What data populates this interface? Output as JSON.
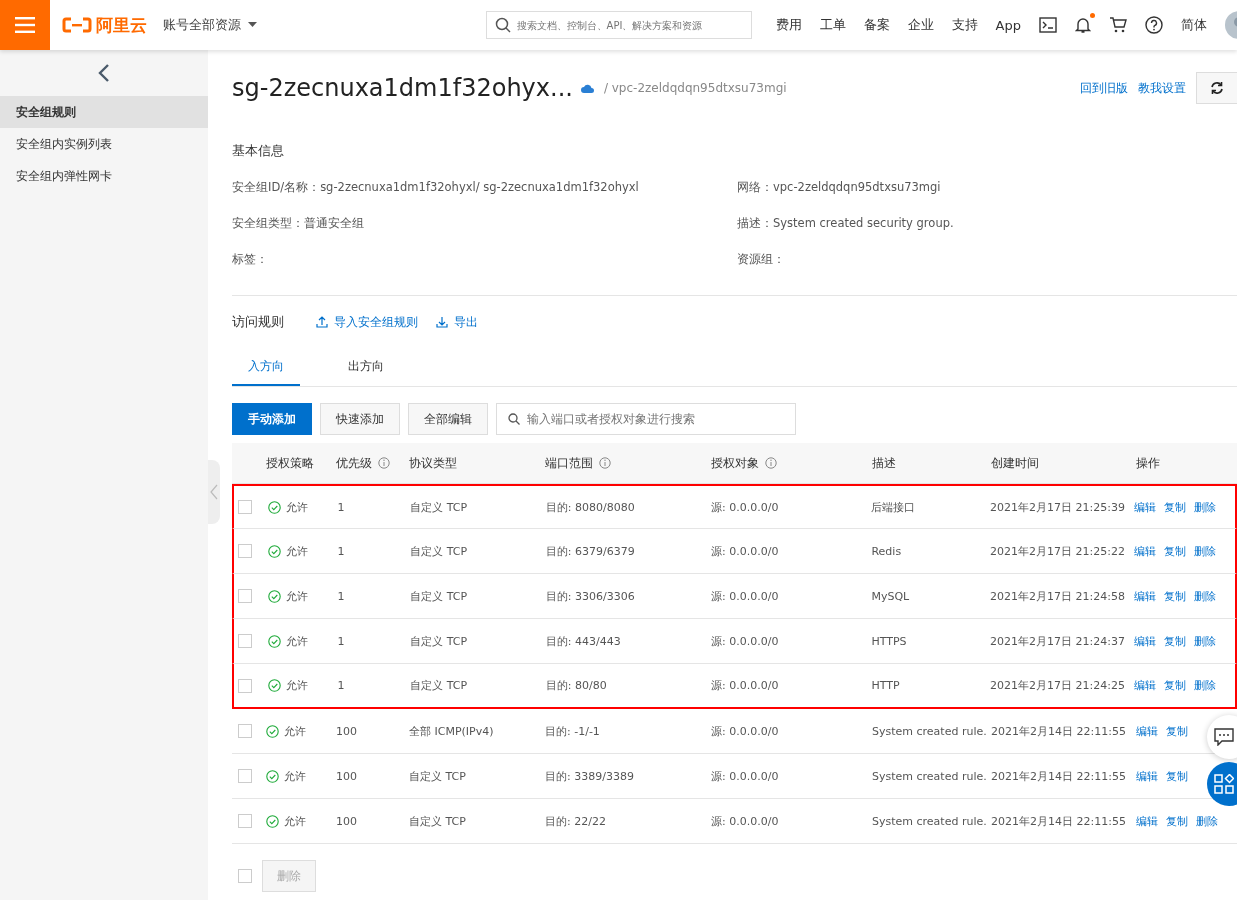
{
  "topbar": {
    "logo_text": "阿里云",
    "account": "账号全部资源",
    "search": {
      "placeholder": "搜索文档、控制台、API、解决方案和资源"
    },
    "nav": [
      "费用",
      "工单",
      "备案",
      "企业",
      "支持",
      "App"
    ],
    "notification_dot": true,
    "language": "简体"
  },
  "sidebar": {
    "items": [
      {
        "label": "安全组规则",
        "selected": true
      },
      {
        "label": "安全组内实例列表",
        "selected": false
      },
      {
        "label": "安全组内弹性网卡",
        "selected": false
      }
    ]
  },
  "header": {
    "title": "sg-2zecnuxa1dm1f32ohyx...",
    "vpc": "/ vpc-2zeldqdqn95dtxsu73mgi",
    "links": [
      "回到旧版",
      "教我设置"
    ]
  },
  "basic_info": {
    "heading": "基本信息",
    "fields": [
      {
        "label": "安全组ID/名称：",
        "value": "sg-2zecnuxa1dm1f32ohyxl/ sg-2zecnuxa1dm1f32ohyxl"
      },
      {
        "label": "网络：",
        "value": "vpc-2zeldqdqn95dtxsu73mgi"
      },
      {
        "label": "安全组类型：",
        "value": "普通安全组"
      },
      {
        "label": "描述：",
        "value": "System created security group."
      },
      {
        "label": "标签："
      },
      {
        "label": "资源组："
      }
    ]
  },
  "rules": {
    "heading": "访问规则",
    "actions": [
      {
        "label": "导入安全组规则",
        "kind": "upload"
      },
      {
        "label": "导出",
        "kind": "download"
      }
    ],
    "tabs": [
      {
        "label": "入方向",
        "selected": true
      },
      {
        "label": "出方向",
        "selected": false
      }
    ],
    "buttons": [
      {
        "label": "手动添加",
        "kind": "primary"
      },
      {
        "label": "快速添加",
        "kind": "default"
      },
      {
        "label": "全部编辑",
        "kind": "default"
      }
    ],
    "search": {
      "placeholder": "输入端口或者授权对象进行搜索"
    },
    "table": {
      "columns": [
        {
          "label": "授权策略",
          "info": false
        },
        {
          "label": "优先级",
          "info": true
        },
        {
          "label": "协议类型",
          "info": false
        },
        {
          "label": "端口范围",
          "info": true
        },
        {
          "label": "授权对象",
          "info": true
        },
        {
          "label": "描述",
          "info": false
        },
        {
          "label": "创建时间",
          "info": false
        },
        {
          "label": "操作",
          "info": false
        }
      ],
      "rows": [
        {
          "checked": false,
          "highlighted": true,
          "policy": "允许",
          "priority": "1",
          "protocol": "自定义 TCP",
          "ports": "目的: 8080/8080",
          "source": "源: 0.0.0.0/0",
          "description": "后端接口",
          "created": "2021年2月17日 21:25:39",
          "actions": [
            "编辑",
            "复制",
            "删除"
          ]
        },
        {
          "checked": false,
          "highlighted": true,
          "policy": "允许",
          "priority": "1",
          "protocol": "自定义 TCP",
          "ports": "目的: 6379/6379",
          "source": "源: 0.0.0.0/0",
          "description": "Redis",
          "created": "2021年2月17日 21:25:22",
          "actions": [
            "编辑",
            "复制",
            "删除"
          ]
        },
        {
          "checked": false,
          "highlighted": true,
          "policy": "允许",
          "priority": "1",
          "protocol": "自定义 TCP",
          "ports": "目的: 3306/3306",
          "source": "源: 0.0.0.0/0",
          "description": "MySQL",
          "created": "2021年2月17日 21:24:58",
          "actions": [
            "编辑",
            "复制",
            "删除"
          ]
        },
        {
          "checked": false,
          "highlighted": true,
          "policy": "允许",
          "priority": "1",
          "protocol": "自定义 TCP",
          "ports": "目的: 443/443",
          "source": "源: 0.0.0.0/0",
          "description": "HTTPS",
          "created": "2021年2月17日 21:24:37",
          "actions": [
            "编辑",
            "复制",
            "删除"
          ]
        },
        {
          "checked": false,
          "highlighted": true,
          "policy": "允许",
          "priority": "1",
          "protocol": "自定义 TCP",
          "ports": "目的: 80/80",
          "source": "源: 0.0.0.0/0",
          "description": "HTTP",
          "created": "2021年2月17日 21:24:25",
          "actions": [
            "编辑",
            "复制",
            "删除"
          ]
        },
        {
          "checked": false,
          "highlighted": false,
          "policy": "允许",
          "priority": "100",
          "protocol": "全部 ICMP(IPv4)",
          "ports": "目的: -1/-1",
          "source": "源: 0.0.0.0/0",
          "description": "System created rule.",
          "created": "2021年2月14日 22:11:55",
          "actions": [
            "编辑",
            "复制"
          ]
        },
        {
          "checked": false,
          "highlighted": false,
          "policy": "允许",
          "priority": "100",
          "protocol": "自定义 TCP",
          "ports": "目的: 3389/3389",
          "source": "源: 0.0.0.0/0",
          "description": "System created rule.",
          "created": "2021年2月14日 22:11:55",
          "actions": [
            "编辑",
            "复制"
          ]
        },
        {
          "checked": false,
          "highlighted": false,
          "policy": "允许",
          "priority": "100",
          "protocol": "自定义 TCP",
          "ports": "目的: 22/22",
          "source": "源: 0.0.0.0/0",
          "description": "System created rule.",
          "created": "2021年2月14日 22:11:55",
          "actions": [
            "编辑",
            "复制",
            "删除"
          ]
        }
      ]
    },
    "footer": {
      "select_all_checked": false,
      "delete_button": {
        "label": "删除",
        "disabled": true
      }
    }
  }
}
